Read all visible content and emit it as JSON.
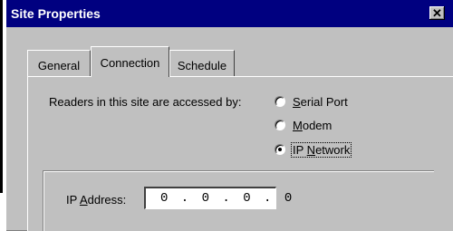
{
  "window": {
    "title": "Site Properties",
    "close_glyph": "✕"
  },
  "tabs": [
    {
      "label": "General",
      "selected": false
    },
    {
      "label": "Connection",
      "selected": true
    },
    {
      "label": "Schedule",
      "selected": false
    }
  ],
  "connection": {
    "access_label": "Readers in this site are accessed by:",
    "options": [
      {
        "label": "Serial Port",
        "mnemonic": "S",
        "selected": false
      },
      {
        "label": "Modem",
        "mnemonic": "M",
        "selected": false
      },
      {
        "label": "IP Network",
        "mnemonic": "N",
        "selected": true
      }
    ],
    "ip_label": "IP Address:",
    "ip_mnemonic": "A",
    "ip_value": "0 . 0 . 0 . 0"
  }
}
